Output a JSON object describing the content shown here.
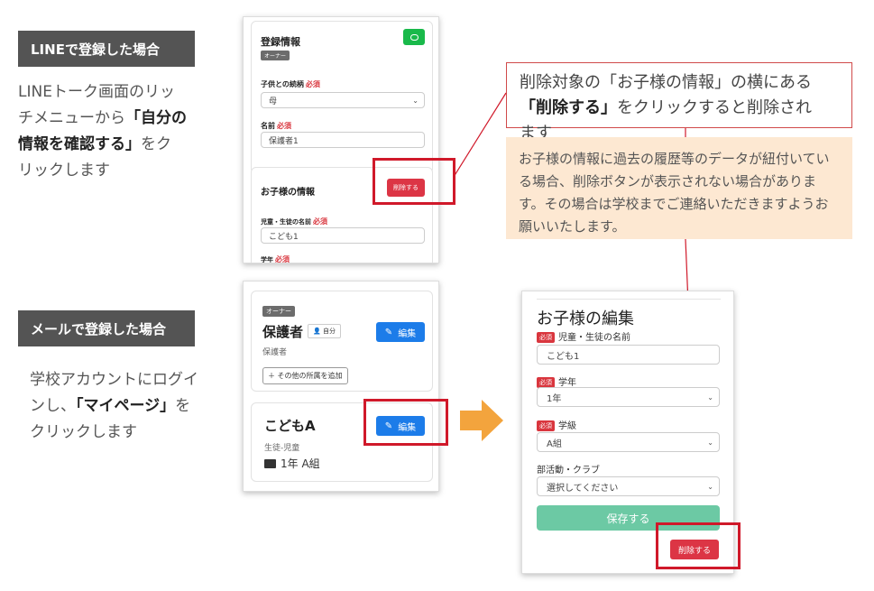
{
  "line_section": {
    "label": "LINEで登録した場合",
    "desc_line1": "LINEトーク画面のリッ",
    "desc_line2_a": "チメニューから",
    "desc_line2_b": "「自分の",
    "desc_line3_a": "情報を確認する」",
    "desc_line3_b": "をク",
    "desc_line4": "リックします"
  },
  "mail_section": {
    "label": "メールで登録した場合",
    "desc_line1": "学校アカウントにログイ",
    "desc_line2_a": "ンし、",
    "desc_line2_b": "「マイページ」",
    "desc_line2_c": "を",
    "desc_line3": "クリックします"
  },
  "line_screen": {
    "reg_title": "登録情報",
    "owner_badge": "オーナー",
    "relation_label": "子供との続柄",
    "required": "必須",
    "relation_value": "母",
    "name_label": "名前",
    "name_value": "保護者1",
    "child_title": "お子様の情報",
    "delete_label": "削除する",
    "child_name_label": "児童・生徒の名前",
    "child_name_value": "こども1",
    "grade_label": "学年"
  },
  "mail_screen": {
    "owner_badge": "オーナー",
    "guardian_name": "保護者",
    "self_tag": "自分",
    "guardian_role": "保護者",
    "edit_label": "編集",
    "add_affiliation": "その他の所属を追加",
    "child_name": "こどもA",
    "child_role": "生徒-児童",
    "child_class": "1年 A組"
  },
  "callouts": {
    "main_a": "削除対象の「お子様の情報」の横にある",
    "main_b": "「削除する」",
    "main_c": "をクリックすると削除され",
    "main_d": "ます",
    "note": "お子様の情報に過去の履歴等のデータが紐付いている場合、削除ボタンが表示されない場合があります。その場合は学校までご連絡いただきますようお願いいたします。"
  },
  "edit_form": {
    "title": "お子様の編集",
    "required": "必須",
    "name_label": "児童・生徒の名前",
    "name_value": "こども1",
    "grade_label": "学年",
    "grade_value": "1年",
    "class_label": "学級",
    "class_value": "A組",
    "club_label": "部活動・クラブ",
    "club_value": "選択してください",
    "save_label": "保存する",
    "delete_label": "削除する"
  },
  "colors": {
    "highlight_red": "#d0192a",
    "delete_red": "#dc3545",
    "edit_blue": "#1c7ce9",
    "save_green": "#6cc9a4",
    "line_green": "#19b94a",
    "arrow_orange": "#f3a43d",
    "note_bg": "#fde8d2"
  }
}
